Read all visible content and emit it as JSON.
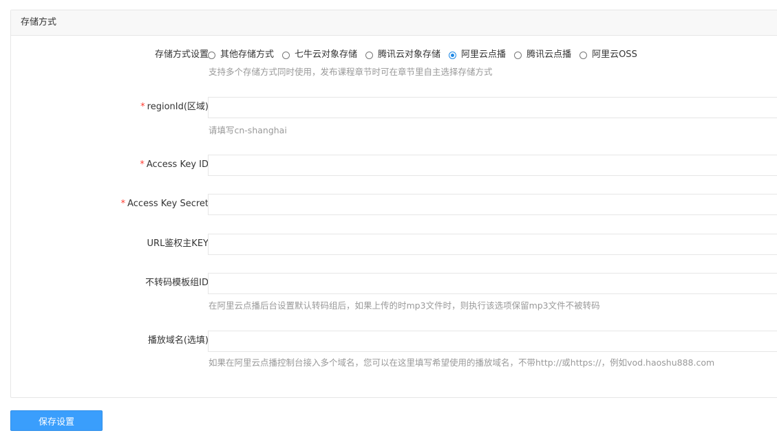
{
  "panel": {
    "title": "存储方式"
  },
  "storage": {
    "label": "存储方式设置",
    "options": [
      {
        "label": "其他存储方式",
        "checked": false
      },
      {
        "label": "七牛云对象存储",
        "checked": false
      },
      {
        "label": "腾讯云对象存储",
        "checked": false
      },
      {
        "label": "阿里云点播",
        "checked": true
      },
      {
        "label": "腾讯云点播",
        "checked": false
      },
      {
        "label": "阿里云OSS",
        "checked": false
      }
    ],
    "hint": "支持多个存储方式同时使用，发布课程章节时可在章节里自主选择存储方式"
  },
  "fields": {
    "region": {
      "required_mark": "*",
      "label": "regionId(区域)",
      "value": "",
      "hint": "请填写cn-shanghai"
    },
    "access_key_id": {
      "required_mark": "*",
      "label": "Access Key ID",
      "value": ""
    },
    "access_key_secret": {
      "required_mark": "*",
      "label": "Access Key Secret",
      "value": ""
    },
    "url_auth_key": {
      "label": "URL鉴权主KEY",
      "value": ""
    },
    "template_group": {
      "label": "不转码模板组ID",
      "value": "",
      "hint": "在阿里云点播后台设置默认转码组后，如果上传的时mp3文件时，则执行该选项保留mp3文件不被转码"
    },
    "play_domain": {
      "label": "播放域名(选填)",
      "value": "",
      "hint": "如果在阿里云点播控制台接入多个域名，您可以在这里填写希望使用的播放域名，不带http://或https://，例如vod.haoshu888.com"
    }
  },
  "actions": {
    "save_label": "保存设置"
  },
  "colors": {
    "accent": "#3a9efc",
    "required": "#ff3b30",
    "hint": "#999999"
  }
}
